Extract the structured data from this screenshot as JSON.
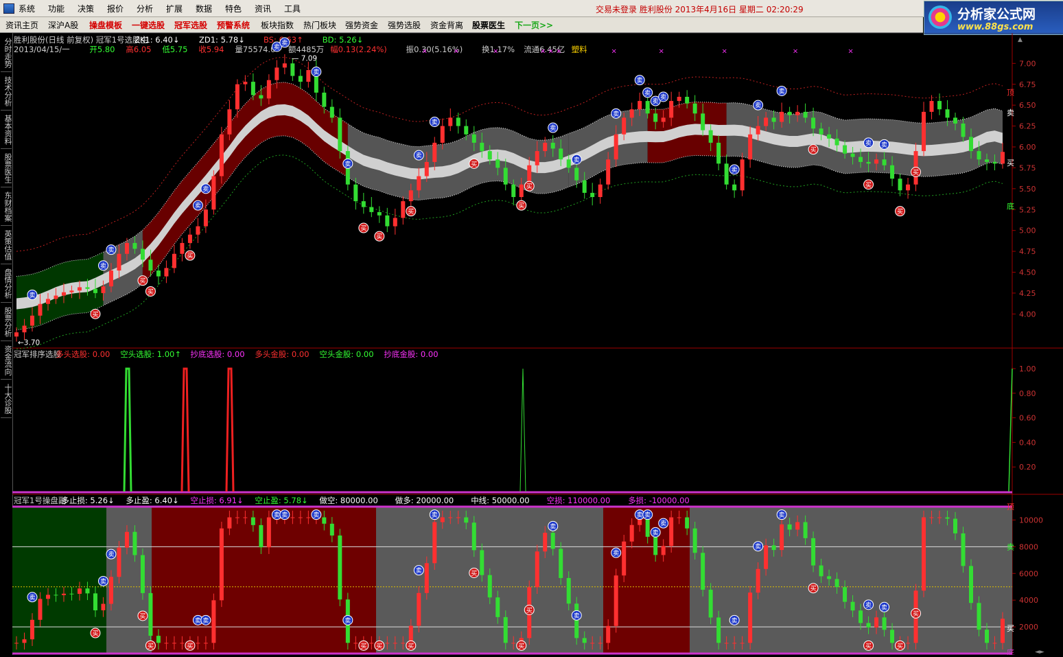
{
  "menu": {
    "items": [
      "系统",
      "功能",
      "决策",
      "报价",
      "分析",
      "扩展",
      "数据",
      "特色",
      "资讯",
      "工具"
    ],
    "status": "交易未登录  胜利股份  2013年4月16日  星期二  02:20:29"
  },
  "toolbar": {
    "tabs": [
      {
        "label": "资讯主页",
        "style": "normal"
      },
      {
        "label": "深沪A股",
        "style": "normal"
      },
      {
        "label": "操盘模板",
        "style": "red"
      },
      {
        "label": "一键选股",
        "style": "red"
      },
      {
        "label": "冠军选股",
        "style": "red"
      },
      {
        "label": "预警系统",
        "style": "red"
      },
      {
        "label": "板块指数",
        "style": "normal"
      },
      {
        "label": "热门板块",
        "style": "normal"
      },
      {
        "label": "强势资金",
        "style": "normal"
      },
      {
        "label": "强势选股",
        "style": "normal"
      },
      {
        "label": "资金背离",
        "style": "normal"
      },
      {
        "label": "股票医生",
        "style": "bold"
      },
      {
        "label": "下一页>>",
        "style": "green"
      }
    ]
  },
  "logo": {
    "title": "分析家公式网",
    "url": "www.88gs.com"
  },
  "sidebar": {
    "tabs": [
      "分时走势",
      "技术分析",
      "基本资料",
      "股票医生",
      "东财档案",
      "英策估值",
      "盘情分析",
      "股票分析",
      "资金流向",
      "十大诊股"
    ]
  },
  "main_panel": {
    "header1": [
      {
        "text": "胜利股份(日线 前复权) 冠军1号选股主",
        "color": "#cccccc"
      },
      {
        "text": "ZK1: 6.40↓",
        "color": "#ffffff"
      },
      {
        "text": "ZD1: 5.78↓",
        "color": "#ffffff"
      },
      {
        "text": "BS: 6.63↑",
        "color": "#ff3030"
      },
      {
        "text": "BD: 5.26↓",
        "color": "#33ff33"
      }
    ],
    "header2": [
      {
        "text": "2013/04/15/一",
        "color": "#cccccc"
      },
      {
        "text": "开5.80",
        "color": "#33ff33"
      },
      {
        "text": "高6.05",
        "color": "#ff3030"
      },
      {
        "text": "低5.75",
        "color": "#33ff33"
      },
      {
        "text": "收5.94",
        "color": "#ff3030"
      },
      {
        "text": "量75574.0",
        "color": "#cccccc"
      },
      {
        "text": "额4485万",
        "color": "#cccccc"
      },
      {
        "text": "幅0.13(2.24%)",
        "color": "#ff3030"
      },
      {
        "text": "振0.30(5.16%)",
        "color": "#cccccc"
      },
      {
        "text": "换1.17%",
        "color": "#cccccc"
      },
      {
        "text": "流通6.45亿",
        "color": "#cccccc"
      },
      {
        "text": "塑料",
        "color": "#ffd400"
      }
    ],
    "y_ticks": [
      "7.00",
      "6.75",
      "6.50",
      "6.25",
      "6.00",
      "5.75",
      "5.50",
      "5.25",
      "5.00",
      "4.75",
      "4.50",
      "4.25",
      "4.00"
    ],
    "band_labels": {
      "top": "顶",
      "sell": "卖",
      "buy": "买",
      "bottom": "底"
    },
    "high_label": "7.09",
    "low_label": "3.70"
  },
  "mid_panel": {
    "header": [
      {
        "text": "冠军排序选股",
        "color": "#cccccc"
      },
      {
        "text": "多头选股: 0.00",
        "color": "#ff3030"
      },
      {
        "text": "空头选股: 1.00↑",
        "color": "#33ff33"
      },
      {
        "text": "抄底选股: 0.00",
        "color": "#ff33ff"
      },
      {
        "text": "多头金股: 0.00",
        "color": "#ff3030"
      },
      {
        "text": "空头金股: 0.00",
        "color": "#33ff33"
      },
      {
        "text": "抄底金股: 0.00",
        "color": "#ff33ff"
      }
    ],
    "y_ticks": [
      "1.00",
      "0.80",
      "0.60",
      "0.40",
      "0.20"
    ]
  },
  "bottom_panel": {
    "header": [
      {
        "text": "冠军1号操盘副",
        "color": "#cccccc"
      },
      {
        "text": "多止损: 5.26↓",
        "color": "#ffffff"
      },
      {
        "text": "多止盈: 6.40↓",
        "color": "#ffffff"
      },
      {
        "text": "空止损: 6.91↓",
        "color": "#ff33ff"
      },
      {
        "text": "空止盈: 5.78↓",
        "color": "#33ff33"
      },
      {
        "text": "做空: 80000.00",
        "color": "#ffffff"
      },
      {
        "text": "做多: 20000.00",
        "color": "#ffffff"
      },
      {
        "text": "中线: 50000.00",
        "color": "#ffffff"
      },
      {
        "text": "空损: 110000.00",
        "color": "#ff33ff"
      },
      {
        "text": "多损: -10000.00",
        "color": "#ff33ff"
      }
    ],
    "y_ticks": [
      "10000",
      "8000",
      "6000",
      "4000",
      "2000"
    ],
    "band_labels": {
      "top": "顶",
      "sell": "卖",
      "buy": "买",
      "bottom": "底"
    }
  },
  "signals": {
    "buy": "买",
    "sell": "卖"
  },
  "colors": {
    "up": "#ff3030",
    "down": "#33dd33",
    "axis": "#a00000",
    "band_light": "#d0d0d0",
    "band_gray": "#5a5a5a",
    "band_red": "#6e0000",
    "band_green": "#003a00",
    "magenta": "#cc33cc"
  },
  "chart_data": [
    {
      "type": "candlestick",
      "title": "胜利股份(日线 前复权)",
      "ylim": [
        3.6,
        7.2
      ],
      "annotations": [
        "7.09",
        "3.70"
      ],
      "series": [
        {
          "name": "收盘",
          "values": [
            3.78,
            3.86,
            3.98,
            4.12,
            4.18,
            4.22,
            4.26,
            4.28,
            4.32,
            4.3,
            4.25,
            4.33,
            4.52,
            4.72,
            4.85,
            4.78,
            4.65,
            4.52,
            4.45,
            4.55,
            4.72,
            4.85,
            4.95,
            5.05,
            5.25,
            5.65,
            6.15,
            6.45,
            6.75,
            6.78,
            6.62,
            6.58,
            6.8,
            6.95,
            7.0,
            6.85,
            6.78,
            6.92,
            6.65,
            6.48,
            6.35,
            5.95,
            5.55,
            5.35,
            5.28,
            5.22,
            5.18,
            5.05,
            5.15,
            5.35,
            5.48,
            5.65,
            5.82,
            6.05,
            6.25,
            6.35,
            6.25,
            6.15,
            6.05,
            5.95,
            5.85,
            5.75,
            5.55,
            5.4,
            5.55,
            5.78,
            5.95,
            6.05,
            5.98,
            5.85,
            5.75,
            5.6,
            5.45,
            5.4,
            5.55,
            5.85,
            6.15,
            6.35,
            6.45,
            6.55,
            6.4,
            6.3,
            6.35,
            6.55,
            6.6,
            6.52,
            6.4,
            6.2,
            6.05,
            5.8,
            5.55,
            5.48,
            5.85,
            6.15,
            6.25,
            6.35,
            6.3,
            6.42,
            6.38,
            6.42,
            6.35,
            6.22,
            6.15,
            6.1,
            6.02,
            5.92,
            5.88,
            5.82,
            5.8,
            5.85,
            5.78,
            5.62,
            5.48,
            5.55,
            5.95,
            6.42,
            6.55,
            6.45,
            6.35,
            6.28,
            6.12,
            5.95,
            5.85,
            5.82,
            5.8,
            5.94
          ]
        }
      ]
    },
    {
      "type": "line",
      "title": "冠军排序选股",
      "ylim": [
        0,
        1.05
      ],
      "series": [
        {
          "name": "空头选股",
          "points": [
            [
              0.1,
              1.0
            ],
            [
              0.47,
              1.0
            ],
            [
              0.98,
              1.0
            ]
          ]
        },
        {
          "name": "多头选股",
          "points": [
            [
              0.16,
              1.0
            ],
            [
              0.2,
              1.0
            ]
          ]
        }
      ]
    },
    {
      "type": "candlestick",
      "title": "冠军1号操盘副",
      "ylim": [
        0,
        11000
      ],
      "series": [
        {
          "name": "做空",
          "values": [
            80000
          ]
        },
        {
          "name": "做多",
          "values": [
            20000
          ]
        },
        {
          "name": "中线",
          "values": [
            50000
          ]
        }
      ]
    }
  ]
}
